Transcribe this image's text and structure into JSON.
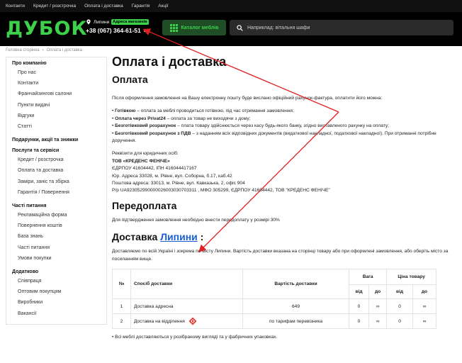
{
  "topbar": {
    "links": [
      "Контакти",
      "Кредит / розстрочка",
      "Оплата і доставка",
      "Гарантія",
      "Акції"
    ]
  },
  "header": {
    "logo": "ДУБОК",
    "city": "Липини",
    "city_badge": "Адреса магазинів",
    "phone": "+38 (067) 364-61-51",
    "catalog_label": "Каталог меблів",
    "search_placeholder": "Наприклад: вітальня шафи"
  },
  "breadcrumb": {
    "home": "Головна сторінка",
    "sep": "›",
    "current": "Оплата і доставка"
  },
  "sidebar": {
    "groups": [
      {
        "head": "Про компанію",
        "items": [
          "Про нас",
          "Контакти",
          "Франчайзингові салони",
          "Пункти видачі",
          "Відгуки",
          "Статті"
        ]
      },
      {
        "head": "Подарунки, акції та знижки",
        "items": []
      },
      {
        "head": "Послуги та сервіси",
        "items": [
          "Кредит / розстрочка",
          "Оплата та доставка",
          "Заміри, заніс та збірка",
          "Гарантія / Повернення"
        ]
      },
      {
        "head": "Часті питання",
        "items": [
          "Рекламаційна форма",
          "Повернення коштів",
          "База знань",
          "Часті питання",
          "Умови покупки"
        ]
      },
      {
        "head": "Додатково",
        "items": [
          "Співпраця",
          "Оптовим покупцям",
          "Виробники",
          "Вакансії"
        ]
      }
    ]
  },
  "main": {
    "title": "Оплата і доставка",
    "payment": {
      "heading": "Оплата",
      "intro": "Після оформлення замовлення на Вашу електронну пошту буде вислано офіційний рахунок-фактура, оплатити його можна:",
      "bullets": [
        {
          "b": "Готівкою",
          "t": " – оплата за меблі проводиться готівкою, під час отримання замовлення;"
        },
        {
          "b": "Оплата через Privat24",
          "t": " – оплата за товар не виходячи з дому;"
        },
        {
          "b": "Безготівковий розрахунок",
          "t": " – плата товару здійснюється через касу будь-якого банку, згідно виставленого рахунку на оплату;"
        },
        {
          "b": "Безготівковий розрахунок з ПДВ",
          "t": " – з наданням всіх відповідних документів (видаткової накладної, податкової накладної). При отриманні потрібне доручення."
        }
      ],
      "requisites": [
        "Реквізити для юридичних осіб:",
        "ТОВ «КРЕДЕНС ФЕНІЧЕ»",
        "ЄДРПОУ 41604442, ІПН 416044417167",
        "Юр. Адреса 33028, м. Рівне, вул. Соборна, б.17, каб.42",
        "Поштова адреса: 33013, м. Рівне, вул. Кавказька, 2, офіс 904",
        "Р/р UA923052990000026003030703311 , МФО 305299, ЄДРПОУ 41604442, ТОВ \"КРЕДЕНС ФЕНІЧЕ\""
      ]
    },
    "prepay": {
      "heading": "Передоплата",
      "text": "Для підтвердження замовлення необхідно внести передоплату у розмірі 30%"
    },
    "delivery": {
      "heading_prefix": "Доставка",
      "heading_city": "Липини",
      "heading_suffix": " :",
      "text": "Доставляємо по всій Україні і зокрема по місту Липини. Вартість доставки вказана на сторінці товару або при оформлені замовлення, або оберіть місто за посиланням вище.",
      "table": {
        "h_num": "№",
        "h_method": "Спосіб доставки",
        "h_cost": "Вартість доставки",
        "h_weight": "Вага",
        "h_price": "Ціна товару",
        "h_from": "від",
        "h_to": "до",
        "rows": [
          {
            "n": "1",
            "method": "Доставка адресна",
            "cost": "649",
            "w_from": "0",
            "w_to": "∞",
            "p_from": "0",
            "p_to": "∞"
          },
          {
            "n": "2",
            "method": "Доставка на відділення",
            "cost": "по тарифам перевізника",
            "w_from": "0",
            "w_to": "∞",
            "p_from": "0",
            "p_to": "∞"
          }
        ]
      },
      "footnote": "• Всі меблі доставляються у розібраному вигляді та у фабричних упаковках."
    }
  },
  "colors": {
    "accent": "#3cd04b",
    "link": "#1a5fd6",
    "arrow": "#e02020"
  }
}
